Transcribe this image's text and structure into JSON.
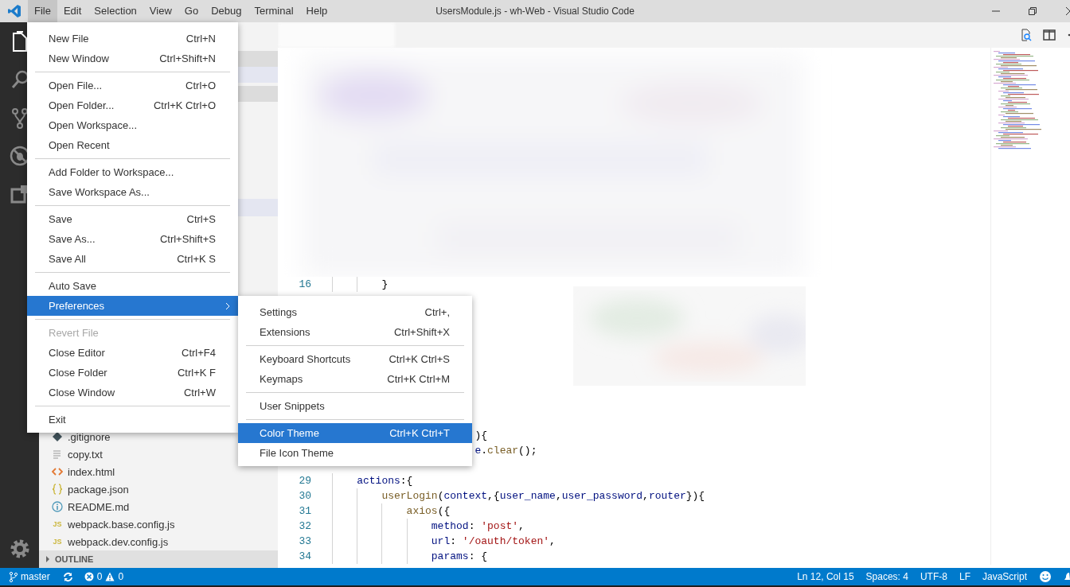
{
  "window": {
    "title": "UsersModule.js - wh-Web - Visual Studio Code"
  },
  "menu_bar": [
    {
      "label": "File",
      "selected": true
    },
    {
      "label": "Edit",
      "selected": false
    },
    {
      "label": "Selection",
      "selected": false
    },
    {
      "label": "View",
      "selected": false
    },
    {
      "label": "Go",
      "selected": false
    },
    {
      "label": "Debug",
      "selected": false
    },
    {
      "label": "Terminal",
      "selected": false
    },
    {
      "label": "Help",
      "selected": false
    }
  ],
  "file_menu": [
    {
      "kind": "item",
      "label": "New File",
      "shortcut": "Ctrl+N",
      "disabled": false,
      "selected": false
    },
    {
      "kind": "item",
      "label": "New Window",
      "shortcut": "Ctrl+Shift+N",
      "disabled": false,
      "selected": false
    },
    {
      "kind": "separator"
    },
    {
      "kind": "item",
      "label": "Open File...",
      "shortcut": "Ctrl+O",
      "disabled": false,
      "selected": false
    },
    {
      "kind": "item",
      "label": "Open Folder...",
      "shortcut": "Ctrl+K Ctrl+O",
      "disabled": false,
      "selected": false
    },
    {
      "kind": "item",
      "label": "Open Workspace...",
      "disabled": false,
      "selected": false
    },
    {
      "kind": "item",
      "label": "Open Recent",
      "disabled": false,
      "selected": false
    },
    {
      "kind": "separator"
    },
    {
      "kind": "item",
      "label": "Add Folder to Workspace...",
      "disabled": false,
      "selected": false
    },
    {
      "kind": "item",
      "label": "Save Workspace As...",
      "disabled": false,
      "selected": false
    },
    {
      "kind": "separator"
    },
    {
      "kind": "item",
      "label": "Save",
      "shortcut": "Ctrl+S",
      "disabled": false,
      "selected": false
    },
    {
      "kind": "item",
      "label": "Save As...",
      "shortcut": "Ctrl+Shift+S",
      "disabled": false,
      "selected": false
    },
    {
      "kind": "item",
      "label": "Save All",
      "shortcut": "Ctrl+K S",
      "disabled": false,
      "selected": false
    },
    {
      "kind": "separator"
    },
    {
      "kind": "item",
      "label": "Auto Save",
      "disabled": false,
      "selected": false
    },
    {
      "kind": "submenu",
      "label": "Preferences",
      "disabled": false,
      "selected": true
    },
    {
      "kind": "separator"
    },
    {
      "kind": "item",
      "label": "Revert File",
      "disabled": true,
      "selected": false
    },
    {
      "kind": "item",
      "label": "Close Editor",
      "shortcut": "Ctrl+F4",
      "disabled": false,
      "selected": false
    },
    {
      "kind": "item",
      "label": "Close Folder",
      "shortcut": "Ctrl+K F",
      "disabled": false,
      "selected": false
    },
    {
      "kind": "item",
      "label": "Close Window",
      "shortcut": "Ctrl+W",
      "disabled": false,
      "selected": false
    },
    {
      "kind": "separator"
    },
    {
      "kind": "item",
      "label": "Exit",
      "disabled": false,
      "selected": false
    }
  ],
  "preferences_submenu": [
    {
      "kind": "item",
      "label": "Settings",
      "shortcut": "Ctrl+,",
      "disabled": false,
      "selected": false
    },
    {
      "kind": "item",
      "label": "Extensions",
      "shortcut": "Ctrl+Shift+X",
      "disabled": false,
      "selected": false
    },
    {
      "kind": "separator"
    },
    {
      "kind": "item",
      "label": "Keyboard Shortcuts",
      "shortcut": "Ctrl+K Ctrl+S",
      "disabled": false,
      "selected": false
    },
    {
      "kind": "item",
      "label": "Keymaps",
      "shortcut": "Ctrl+K Ctrl+M",
      "disabled": false,
      "selected": false
    },
    {
      "kind": "separator"
    },
    {
      "kind": "item",
      "label": "User Snippets",
      "disabled": false,
      "selected": false
    },
    {
      "kind": "separator"
    },
    {
      "kind": "item",
      "label": "Color Theme",
      "shortcut": "Ctrl+K Ctrl+T",
      "disabled": false,
      "selected": true
    },
    {
      "kind": "item",
      "label": "File Icon Theme",
      "disabled": false,
      "selected": false
    }
  ],
  "activity_bar": [
    {
      "kind": "files",
      "selected": true
    },
    {
      "kind": "search",
      "selected": false
    },
    {
      "kind": "source-control",
      "selected": false
    },
    {
      "kind": "debug",
      "selected": false
    },
    {
      "kind": "extensions",
      "selected": false
    },
    {
      "kind": "settings",
      "selected": false
    }
  ],
  "explorer": {
    "files": [
      {
        "name": ".gitignore",
        "kind": "git"
      },
      {
        "name": "copy.txt",
        "kind": "text"
      },
      {
        "name": "index.html",
        "kind": "html"
      },
      {
        "name": "package.json",
        "kind": "json"
      },
      {
        "name": "README.md",
        "kind": "info"
      },
      {
        "name": "webpack.base.config.js",
        "kind": "js",
        "badge": "JS"
      },
      {
        "name": "webpack.dev.config.js",
        "kind": "js",
        "badge": "JS"
      }
    ],
    "outline": {
      "label": "OUTLINE",
      "expanded": false
    }
  },
  "editor": {
    "rows": [
      {
        "kind": "code",
        "number": "16",
        "tokens": [
          {
            "kind": "plain",
            "text": "        }"
          }
        ]
      },
      {
        "kind": "covered"
      },
      {
        "kind": "covered"
      },
      {
        "kind": "covered"
      },
      {
        "kind": "covered"
      },
      {
        "kind": "covered"
      },
      {
        "kind": "covered"
      },
      {
        "kind": "covered"
      },
      {
        "kind": "covered"
      },
      {
        "kind": "covered"
      },
      {
        "kind": "code",
        "tokens": [
          {
            "kind": "plain",
            "text": "                       ){"
          }
        ]
      },
      {
        "kind": "code",
        "tokens": [
          {
            "kind": "var",
            "text": "                       e"
          },
          {
            "kind": "plain",
            "text": "."
          },
          {
            "kind": "fn",
            "text": "clear"
          },
          {
            "kind": "plain",
            "text": "();"
          }
        ]
      },
      {
        "kind": "covered"
      },
      {
        "kind": "code",
        "number": "29",
        "tokens": [
          {
            "kind": "var",
            "text": "    actions"
          },
          {
            "kind": "plain",
            "text": ":{"
          }
        ]
      },
      {
        "kind": "code",
        "number": "30",
        "tokens": [
          {
            "kind": "fn",
            "text": "        userLogin"
          },
          {
            "kind": "plain",
            "text": "("
          },
          {
            "kind": "var",
            "text": "context"
          },
          {
            "kind": "plain",
            "text": ",{"
          },
          {
            "kind": "var",
            "text": "user_name"
          },
          {
            "kind": "plain",
            "text": ","
          },
          {
            "kind": "var",
            "text": "user_password"
          },
          {
            "kind": "plain",
            "text": ","
          },
          {
            "kind": "var",
            "text": "router"
          },
          {
            "kind": "plain",
            "text": "}){"
          }
        ]
      },
      {
        "kind": "code",
        "number": "31",
        "tokens": [
          {
            "kind": "fn",
            "text": "            axios"
          },
          {
            "kind": "plain",
            "text": "({"
          }
        ]
      },
      {
        "kind": "code",
        "number": "32",
        "tokens": [
          {
            "kind": "var",
            "text": "                method"
          },
          {
            "kind": "plain",
            "text": ": "
          },
          {
            "kind": "str",
            "text": "'post'"
          },
          {
            "kind": "plain",
            "text": ","
          }
        ]
      },
      {
        "kind": "code",
        "number": "33",
        "tokens": [
          {
            "kind": "var",
            "text": "                url"
          },
          {
            "kind": "plain",
            "text": ": "
          },
          {
            "kind": "str",
            "text": "'/oauth/token'"
          },
          {
            "kind": "plain",
            "text": ","
          }
        ]
      },
      {
        "kind": "code",
        "number": "34",
        "tokens": [
          {
            "kind": "var",
            "text": "                params"
          },
          {
            "kind": "plain",
            "text": ": {"
          }
        ]
      }
    ]
  },
  "status_bar": {
    "branch": "master",
    "errors": "0",
    "warnings": "0",
    "position": "Ln 12, Col 15",
    "indentation": "Spaces: 4",
    "encoding": "UTF-8",
    "line_ending": "LF",
    "language": "JavaScript"
  }
}
